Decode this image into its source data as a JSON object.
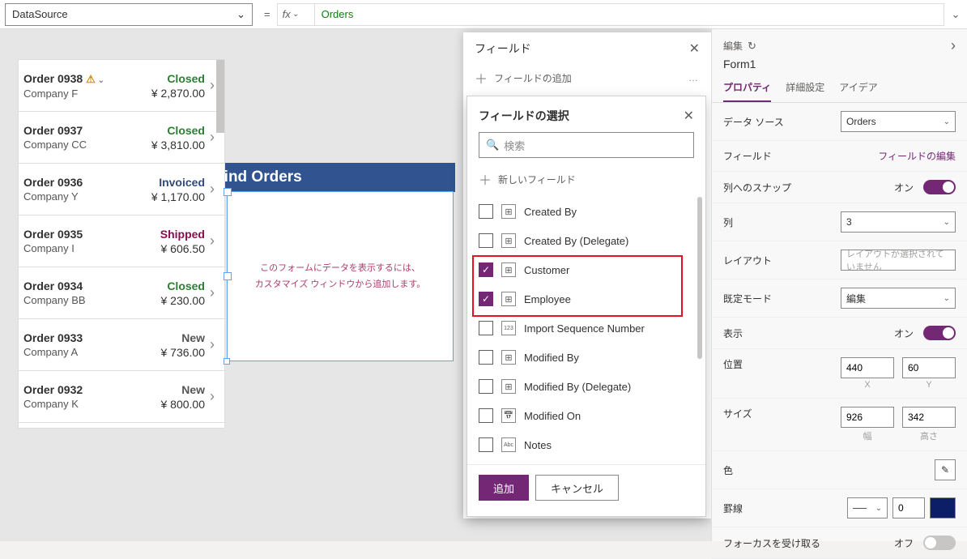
{
  "formula_bar": {
    "property": "DataSource",
    "eq": "=",
    "fx": "fx",
    "value": "Orders"
  },
  "gallery": {
    "title": "Northwind Orders",
    "rows": [
      {
        "order": "Order 0938",
        "company": "Company F",
        "status": "Closed",
        "status_cls": "closed",
        "price": "¥ 2,870.00",
        "warn": true
      },
      {
        "order": "Order 0937",
        "company": "Company CC",
        "status": "Closed",
        "status_cls": "closed",
        "price": "¥ 3,810.00"
      },
      {
        "order": "Order 0936",
        "company": "Company Y",
        "status": "Invoiced",
        "status_cls": "invoiced",
        "price": "¥ 1,170.00"
      },
      {
        "order": "Order 0935",
        "company": "Company I",
        "status": "Shipped",
        "status_cls": "shipped",
        "price": "¥ 606.50"
      },
      {
        "order": "Order 0934",
        "company": "Company BB",
        "status": "Closed",
        "status_cls": "closed",
        "price": "¥ 230.00"
      },
      {
        "order": "Order 0933",
        "company": "Company A",
        "status": "New",
        "status_cls": "new",
        "price": "¥ 736.00"
      },
      {
        "order": "Order 0932",
        "company": "Company K",
        "status": "New",
        "status_cls": "new",
        "price": "¥ 800.00"
      }
    ]
  },
  "form_msg": {
    "l1": "このフォームにデータを表示するには、",
    "l2": "カスタマイズ ウィンドウから追加します。"
  },
  "fields_pane": {
    "title": "フィールド",
    "add": "フィールドの追加"
  },
  "selector": {
    "title": "フィールドの選択",
    "search": "検索",
    "new": "新しいフィールド",
    "add": "追加",
    "cancel": "キャンセル",
    "fields": [
      {
        "name": "Created By",
        "icon": "lk",
        "checked": false
      },
      {
        "name": "Created By (Delegate)",
        "icon": "lk",
        "checked": false
      },
      {
        "name": "Customer",
        "icon": "lk",
        "checked": true
      },
      {
        "name": "Employee",
        "icon": "lk",
        "checked": true
      },
      {
        "name": "Import Sequence Number",
        "icon": "num",
        "checked": false
      },
      {
        "name": "Modified By",
        "icon": "lk",
        "checked": false
      },
      {
        "name": "Modified By (Delegate)",
        "icon": "lk",
        "checked": false
      },
      {
        "name": "Modified On",
        "icon": "cal",
        "checked": false
      },
      {
        "name": "Notes",
        "icon": "txt",
        "checked": false
      }
    ]
  },
  "props": {
    "edit": "編集",
    "refresh": "↻",
    "name": "Form1",
    "tabs": [
      "プロパティ",
      "詳細設定",
      "アイデア"
    ],
    "datasource_lab": "データ ソース",
    "datasource_val": "Orders",
    "fields_lab": "フィールド",
    "fields_link": "フィールドの編集",
    "snap_lab": "列へのスナップ",
    "snap_on": "オン",
    "cols_lab": "列",
    "cols_val": "3",
    "layout_lab": "レイアウト",
    "layout_ph": "レイアウトが選択されていません",
    "defmode_lab": "既定モード",
    "defmode_val": "編集",
    "visible_lab": "表示",
    "visible_on": "オン",
    "pos_lab": "位置",
    "x": "440",
    "y": "60",
    "x_cap": "X",
    "y_cap": "Y",
    "size_lab": "サイズ",
    "w": "926",
    "h": "342",
    "w_cap": "幅",
    "h_cap": "高さ",
    "color_lab": "色",
    "border_lab": "罫線",
    "border_style": "── ",
    "border_w": "0",
    "focus_lab": "フォーカスを受け取る",
    "focus_off": "オフ"
  }
}
